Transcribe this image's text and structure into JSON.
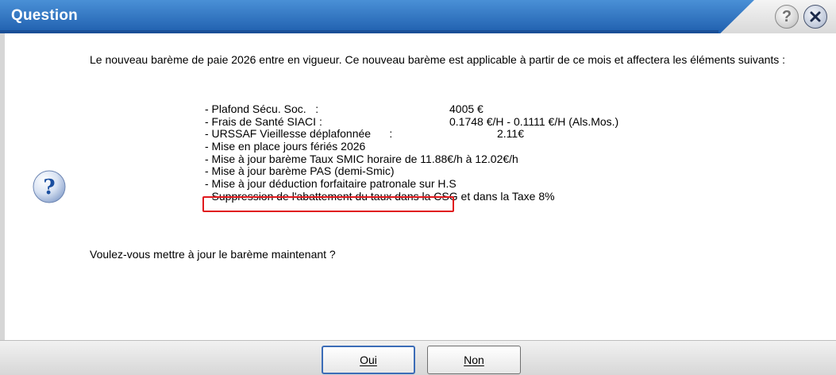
{
  "window": {
    "title": "Question"
  },
  "message": "Le nouveau barème de paie 2026 entre en vigueur. Ce nouveau barème est applicable à partir de ce mois et affectera les éléments suivants :",
  "items": [
    {
      "label": "- Plafond Sécu. Soc.   :",
      "value": "4005 €"
    },
    {
      "label": "- Frais de Santé SIACI :",
      "value": "0.1748 €/H - 0.1111 €/H (Als.Mos.)"
    },
    {
      "label": "- URSSAF Vieillesse déplafonnée      :",
      "value": "2.11€"
    },
    {
      "label": "- Mise en place jours fériés 2026",
      "value": ""
    },
    {
      "label": "- Mise à jour barème Taux SMIC horaire de 11.88€/h à 12.02€/h",
      "value": ""
    },
    {
      "label": "- Mise à jour barème PAS (demi-Smic)",
      "value": ""
    },
    {
      "label": "- Mise à jour déduction forfaitaire patronale sur H.S",
      "value": ""
    },
    {
      "label": "- Suppression de l'abattement du taux dans la CSG et dans la Taxe 8%",
      "value": ""
    }
  ],
  "prompt": "Voulez-vous mettre à jour le barème maintenant ?",
  "buttons": {
    "yes": "Oui",
    "no": "Non"
  },
  "colors": {
    "titlebar": "#2a6bbf",
    "highlight": "#e0191d",
    "icon": "#1b4fa0"
  }
}
